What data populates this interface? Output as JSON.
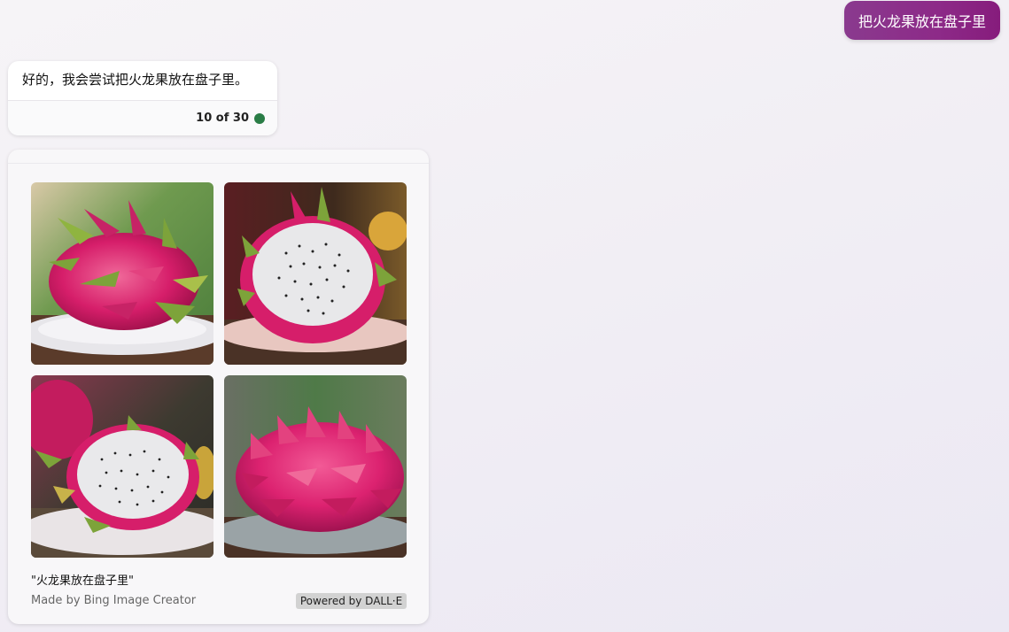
{
  "user_message": {
    "text": "把火龙果放在盘子里"
  },
  "bot_message": {
    "text": "好的，我会尝试把火龙果放在盘子里。",
    "counter": "10 of 30",
    "status_color": "#2a7d46"
  },
  "image_card": {
    "prompt_caption": "\"火龙果放在盘子里\"",
    "made_by": "Made by Bing Image Creator",
    "powered_by": "Powered by DALL·E",
    "images": [
      {
        "name": "dragon-fruit-whole-on-plate"
      },
      {
        "name": "dragon-fruit-halved-on-plate"
      },
      {
        "name": "dragon-fruit-halved-close"
      },
      {
        "name": "dragon-fruit-whole-side"
      }
    ]
  },
  "colors": {
    "user_bubble": "#8d2a88",
    "fruit_pink": "#d61e6a",
    "fruit_green": "#7da33a",
    "flesh_white": "#e8e8ea"
  }
}
